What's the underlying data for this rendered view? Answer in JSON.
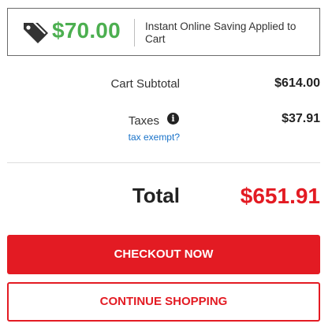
{
  "savings": {
    "amount": "$70.00",
    "text": "Instant Online Saving Applied to Cart",
    "icon": "price-tags-icon",
    "color": "#4caf50"
  },
  "summary": {
    "subtotal_label": "Cart Subtotal",
    "subtotal_value": "$614.00",
    "taxes_label": "Taxes",
    "taxes_info_icon": "info-icon",
    "taxes_value": "$37.91",
    "tax_exempt_link": "tax exempt?",
    "total_label": "Total",
    "total_value": "$651.91",
    "total_color": "#e31b23"
  },
  "actions": {
    "checkout_label": "CHECKOUT NOW",
    "continue_label": "CONTINUE SHOPPING",
    "accent_color": "#e31b23"
  }
}
